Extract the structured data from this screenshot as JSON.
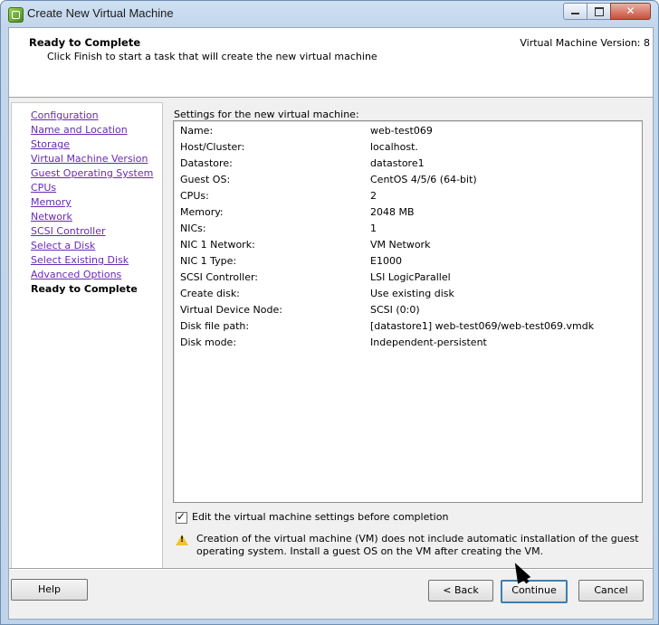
{
  "window": {
    "title": "Create New Virtual Machine"
  },
  "header": {
    "title": "Ready to Complete",
    "subtitle": "Click Finish to start a task that will create the new virtual machine",
    "version": "Virtual Machine Version: 8"
  },
  "nav": {
    "items": [
      {
        "label": "Configuration"
      },
      {
        "label": "Name and Location"
      },
      {
        "label": "Storage"
      },
      {
        "label": "Virtual Machine Version"
      },
      {
        "label": "Guest Operating System"
      },
      {
        "label": "CPUs"
      },
      {
        "label": "Memory"
      },
      {
        "label": "Network"
      },
      {
        "label": "SCSI Controller"
      },
      {
        "label": "Select a Disk"
      },
      {
        "label": "Select Existing Disk"
      },
      {
        "label": "Advanced Options"
      },
      {
        "label": "Ready to Complete",
        "current": true
      }
    ]
  },
  "settings": {
    "label": "Settings for the new virtual machine:",
    "rows": [
      {
        "key": "Name:",
        "value": "web-test069"
      },
      {
        "key": "Host/Cluster:",
        "value": "localhost."
      },
      {
        "key": "Datastore:",
        "value": "datastore1"
      },
      {
        "key": "Guest OS:",
        "value": "CentOS 4/5/6 (64-bit)"
      },
      {
        "key": "CPUs:",
        "value": "2"
      },
      {
        "key": "Memory:",
        "value": "2048 MB"
      },
      {
        "key": "NICs:",
        "value": "1"
      },
      {
        "key": "NIC 1 Network:",
        "value": "VM Network"
      },
      {
        "key": "NIC 1 Type:",
        "value": "E1000"
      },
      {
        "key": "SCSI Controller:",
        "value": "LSI LogicParallel"
      },
      {
        "key": "Create disk:",
        "value": "Use existing disk"
      },
      {
        "key": "Virtual Device Node:",
        "value": "SCSI (0:0)"
      },
      {
        "key": "Disk file path:",
        "value": "[datastore1] web-test069/web-test069.vmdk"
      },
      {
        "key": "Disk mode:",
        "value": "Independent-persistent"
      }
    ]
  },
  "options": {
    "edit_settings_label": "Edit the virtual machine settings before completion",
    "edit_settings_checked": true
  },
  "warning": {
    "text": "Creation of the virtual machine (VM) does not include automatic installation of the guest operating system. Install a guest OS on the VM after creating the VM."
  },
  "buttons": {
    "help": "Help",
    "back": "< Back",
    "continue": "Continue",
    "cancel": "Cancel"
  }
}
